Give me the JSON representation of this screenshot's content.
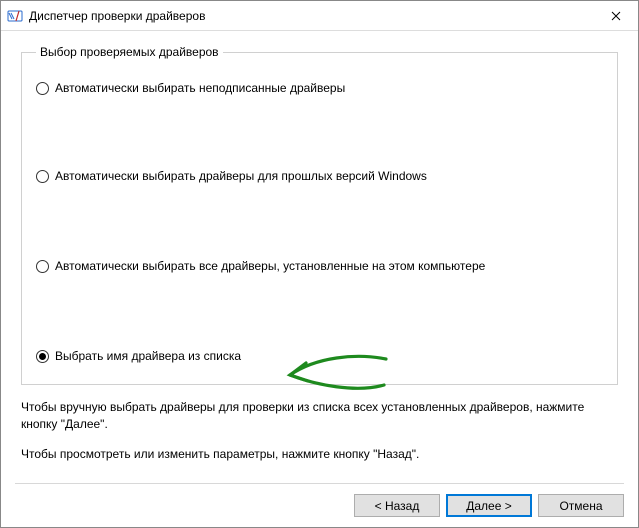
{
  "window": {
    "title": "Диспетчер проверки драйверов"
  },
  "group": {
    "legend": "Выбор проверяемых драйверов",
    "options": [
      {
        "label": "Автоматически выбирать неподписанные драйверы",
        "checked": false
      },
      {
        "label": "Автоматически выбирать драйверы для прошлых версий Windows",
        "checked": false
      },
      {
        "label": "Автоматически выбирать все драйверы, установленные на этом компьютере",
        "checked": false
      },
      {
        "label": "Выбрать имя драйвера из списка",
        "checked": true
      }
    ]
  },
  "help": {
    "line1": "Чтобы вручную выбрать драйверы для проверки из списка всех установленных драйверов, нажмите кнопку \"Далее\".",
    "line2": "Чтобы просмотреть или изменить параметры, нажмите кнопку \"Назад\"."
  },
  "buttons": {
    "back": "< Назад",
    "next": "Далее >",
    "cancel": "Отмена"
  }
}
